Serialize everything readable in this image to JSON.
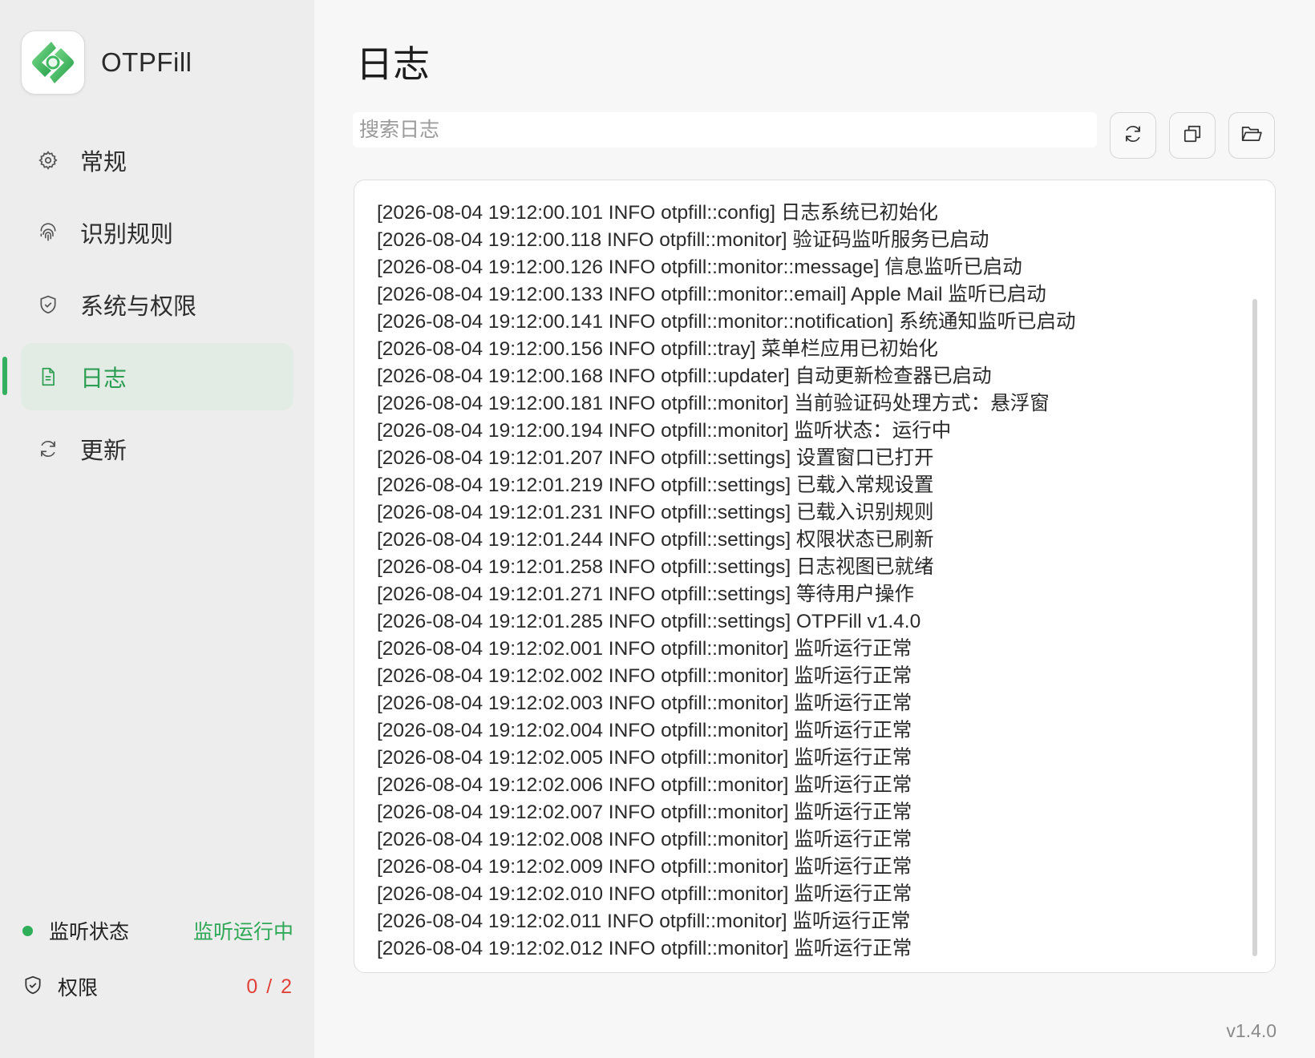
{
  "app": {
    "name": "OTPFill",
    "version": "v1.4.0"
  },
  "sidebar": {
    "items": [
      {
        "label": "常规",
        "icon": "gear-icon"
      },
      {
        "label": "识别规则",
        "icon": "fingerprint-icon"
      },
      {
        "label": "系统与权限",
        "icon": "shield-icon"
      },
      {
        "label": "日志",
        "icon": "document-icon"
      },
      {
        "label": "更新",
        "icon": "refresh-icon"
      }
    ],
    "active_index": 3,
    "status": {
      "label": "监听状态",
      "value": "监听运行中"
    },
    "permissions": {
      "label": "权限",
      "value": "0 / 2"
    }
  },
  "main": {
    "title": "日志",
    "search_placeholder": "搜索日志",
    "toolbar": [
      "refresh-icon",
      "copy-icon",
      "folder-icon"
    ]
  },
  "log_lines": [
    "[2026-08-04 19:12:00.101 INFO otpfill::config] 日志系统已初始化",
    "[2026-08-04 19:12:00.118 INFO otpfill::monitor] 验证码监听服务已启动",
    "[2026-08-04 19:12:00.126 INFO otpfill::monitor::message] 信息监听已启动",
    "[2026-08-04 19:12:00.133 INFO otpfill::monitor::email] Apple Mail 监听已启动",
    "[2026-08-04 19:12:00.141 INFO otpfill::monitor::notification] 系统通知监听已启动",
    "[2026-08-04 19:12:00.156 INFO otpfill::tray] 菜单栏应用已初始化",
    "[2026-08-04 19:12:00.168 INFO otpfill::updater] 自动更新检查器已启动",
    "[2026-08-04 19:12:00.181 INFO otpfill::monitor] 当前验证码处理方式：悬浮窗",
    "[2026-08-04 19:12:00.194 INFO otpfill::monitor] 监听状态：运行中",
    "[2026-08-04 19:12:01.207 INFO otpfill::settings] 设置窗口已打开",
    "[2026-08-04 19:12:01.219 INFO otpfill::settings] 已载入常规设置",
    "[2026-08-04 19:12:01.231 INFO otpfill::settings] 已载入识别规则",
    "[2026-08-04 19:12:01.244 INFO otpfill::settings] 权限状态已刷新",
    "[2026-08-04 19:12:01.258 INFO otpfill::settings] 日志视图已就绪",
    "[2026-08-04 19:12:01.271 INFO otpfill::settings] 等待用户操作",
    "[2026-08-04 19:12:01.285 INFO otpfill::settings] OTPFill v1.4.0",
    "[2026-08-04 19:12:02.001 INFO otpfill::monitor] 监听运行正常",
    "[2026-08-04 19:12:02.002 INFO otpfill::monitor] 监听运行正常",
    "[2026-08-04 19:12:02.003 INFO otpfill::monitor] 监听运行正常",
    "[2026-08-04 19:12:02.004 INFO otpfill::monitor] 监听运行正常",
    "[2026-08-04 19:12:02.005 INFO otpfill::monitor] 监听运行正常",
    "[2026-08-04 19:12:02.006 INFO otpfill::monitor] 监听运行正常",
    "[2026-08-04 19:12:02.007 INFO otpfill::monitor] 监听运行正常",
    "[2026-08-04 19:12:02.008 INFO otpfill::monitor] 监听运行正常",
    "[2026-08-04 19:12:02.009 INFO otpfill::monitor] 监听运行正常",
    "[2026-08-04 19:12:02.010 INFO otpfill::monitor] 监听运行正常",
    "[2026-08-04 19:12:02.011 INFO otpfill::monitor] 监听运行正常",
    "[2026-08-04 19:12:02.012 INFO otpfill::monitor] 监听运行正常"
  ],
  "colors": {
    "accent": "#34b060",
    "active_bg": "#e2ece4",
    "error": "#e0423a"
  }
}
